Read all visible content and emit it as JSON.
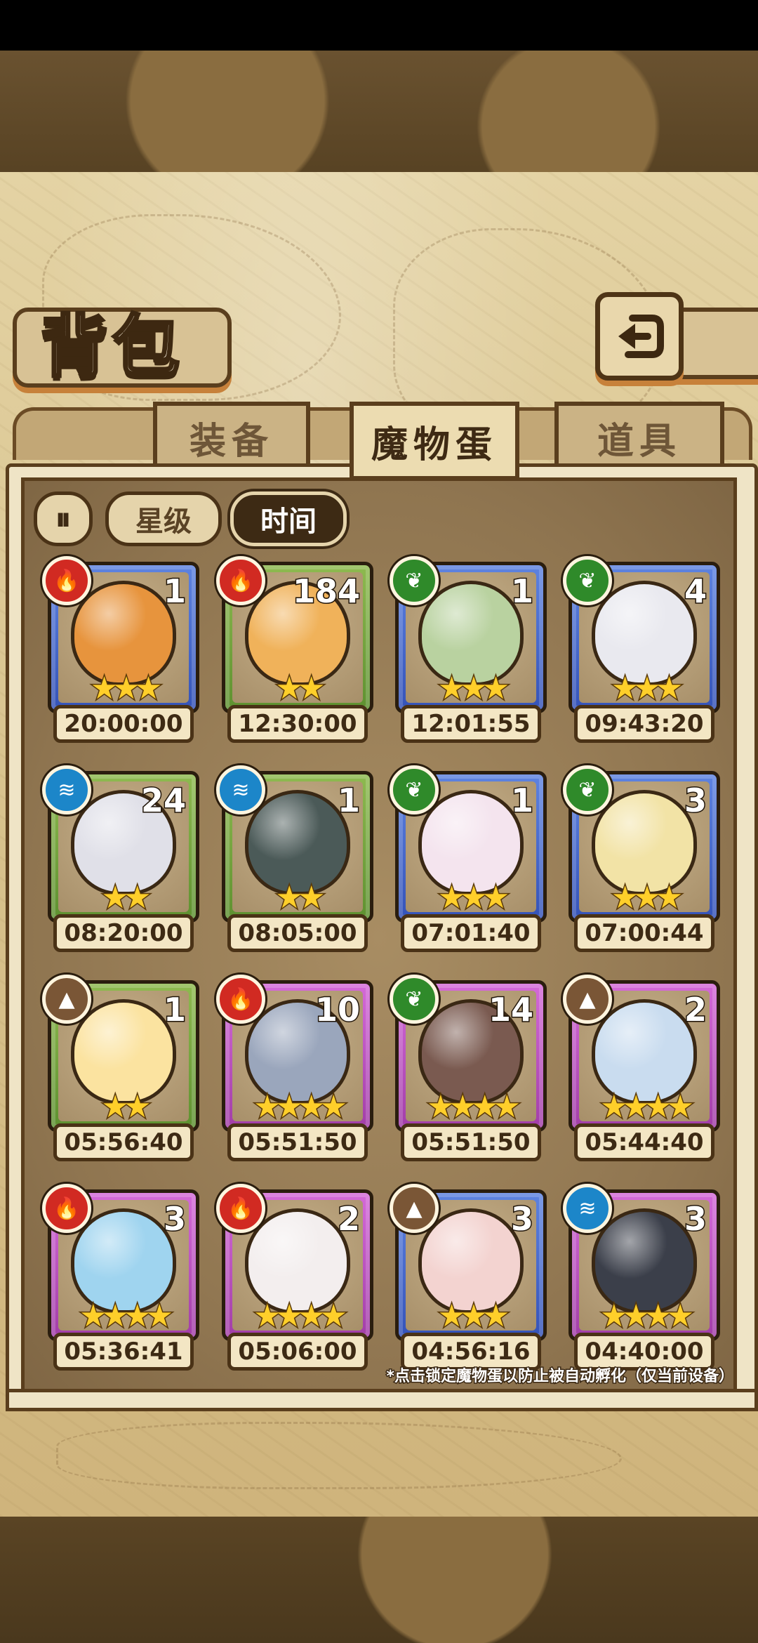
{
  "title": "背包",
  "tabs": [
    {
      "label": "装备",
      "active": false
    },
    {
      "label": "魔物蛋",
      "active": true
    },
    {
      "label": "道具",
      "active": false
    }
  ],
  "filters": {
    "order_icon": "sort-order-icon",
    "star_label": "星级",
    "time_label": "时间",
    "selected": "时间"
  },
  "eggs": [
    {
      "element": "fire",
      "frame": "blue",
      "count": "1",
      "stars": 3,
      "time": "20:00:00",
      "color": "#e7943d"
    },
    {
      "element": "fire",
      "frame": "green",
      "count": "184",
      "stars": 2,
      "time": "12:30:00",
      "color": "#f0b25a"
    },
    {
      "element": "grass",
      "frame": "blue",
      "count": "1",
      "stars": 3,
      "time": "12:01:55",
      "color": "#b9d2a0"
    },
    {
      "element": "grass",
      "frame": "blue",
      "count": "4",
      "stars": 3,
      "time": "09:43:20",
      "color": "#e9e9ef"
    },
    {
      "element": "water",
      "frame": "green",
      "count": "24",
      "stars": 2,
      "time": "08:20:00",
      "color": "#e0e0e8"
    },
    {
      "element": "water",
      "frame": "green",
      "count": "1",
      "stars": 2,
      "time": "08:05:00",
      "color": "#4b5a58"
    },
    {
      "element": "grass",
      "frame": "blue",
      "count": "1",
      "stars": 3,
      "time": "07:01:40",
      "color": "#f4e4ee"
    },
    {
      "element": "grass",
      "frame": "blue",
      "count": "3",
      "stars": 3,
      "time": "07:00:44",
      "color": "#f2e3a6"
    },
    {
      "element": "earth",
      "frame": "green",
      "count": "1",
      "stars": 2,
      "time": "05:56:40",
      "color": "#fbe3a0"
    },
    {
      "element": "fire",
      "frame": "purple",
      "count": "10",
      "stars": 4,
      "time": "05:51:50",
      "color": "#9aa6bc"
    },
    {
      "element": "grass",
      "frame": "purple",
      "count": "14",
      "stars": 4,
      "time": "05:51:50",
      "color": "#7a5a50"
    },
    {
      "element": "earth",
      "frame": "purple",
      "count": "2",
      "stars": 4,
      "time": "05:44:40",
      "color": "#c9dcef"
    },
    {
      "element": "fire",
      "frame": "purple",
      "count": "3",
      "stars": 4,
      "time": "05:36:41",
      "color": "#9fd4ef"
    },
    {
      "element": "fire",
      "frame": "purple",
      "count": "2",
      "stars": 4,
      "time": "05:06:00",
      "color": "#f3eeee"
    },
    {
      "element": "earth",
      "frame": "blue",
      "count": "3",
      "stars": 3,
      "time": "04:56:16",
      "color": "#f3d3d0"
    },
    {
      "element": "water",
      "frame": "purple",
      "count": "3",
      "stars": 4,
      "time": "04:40:00",
      "color": "#3b3f4a"
    }
  ],
  "element_icons": {
    "fire": "fire-icon",
    "grass": "leaf-icon",
    "water": "water-wave-icon",
    "earth": "mountain-icon"
  },
  "note": "*点击锁定魔物蛋以防止被自动孵化（仅当前设备）"
}
